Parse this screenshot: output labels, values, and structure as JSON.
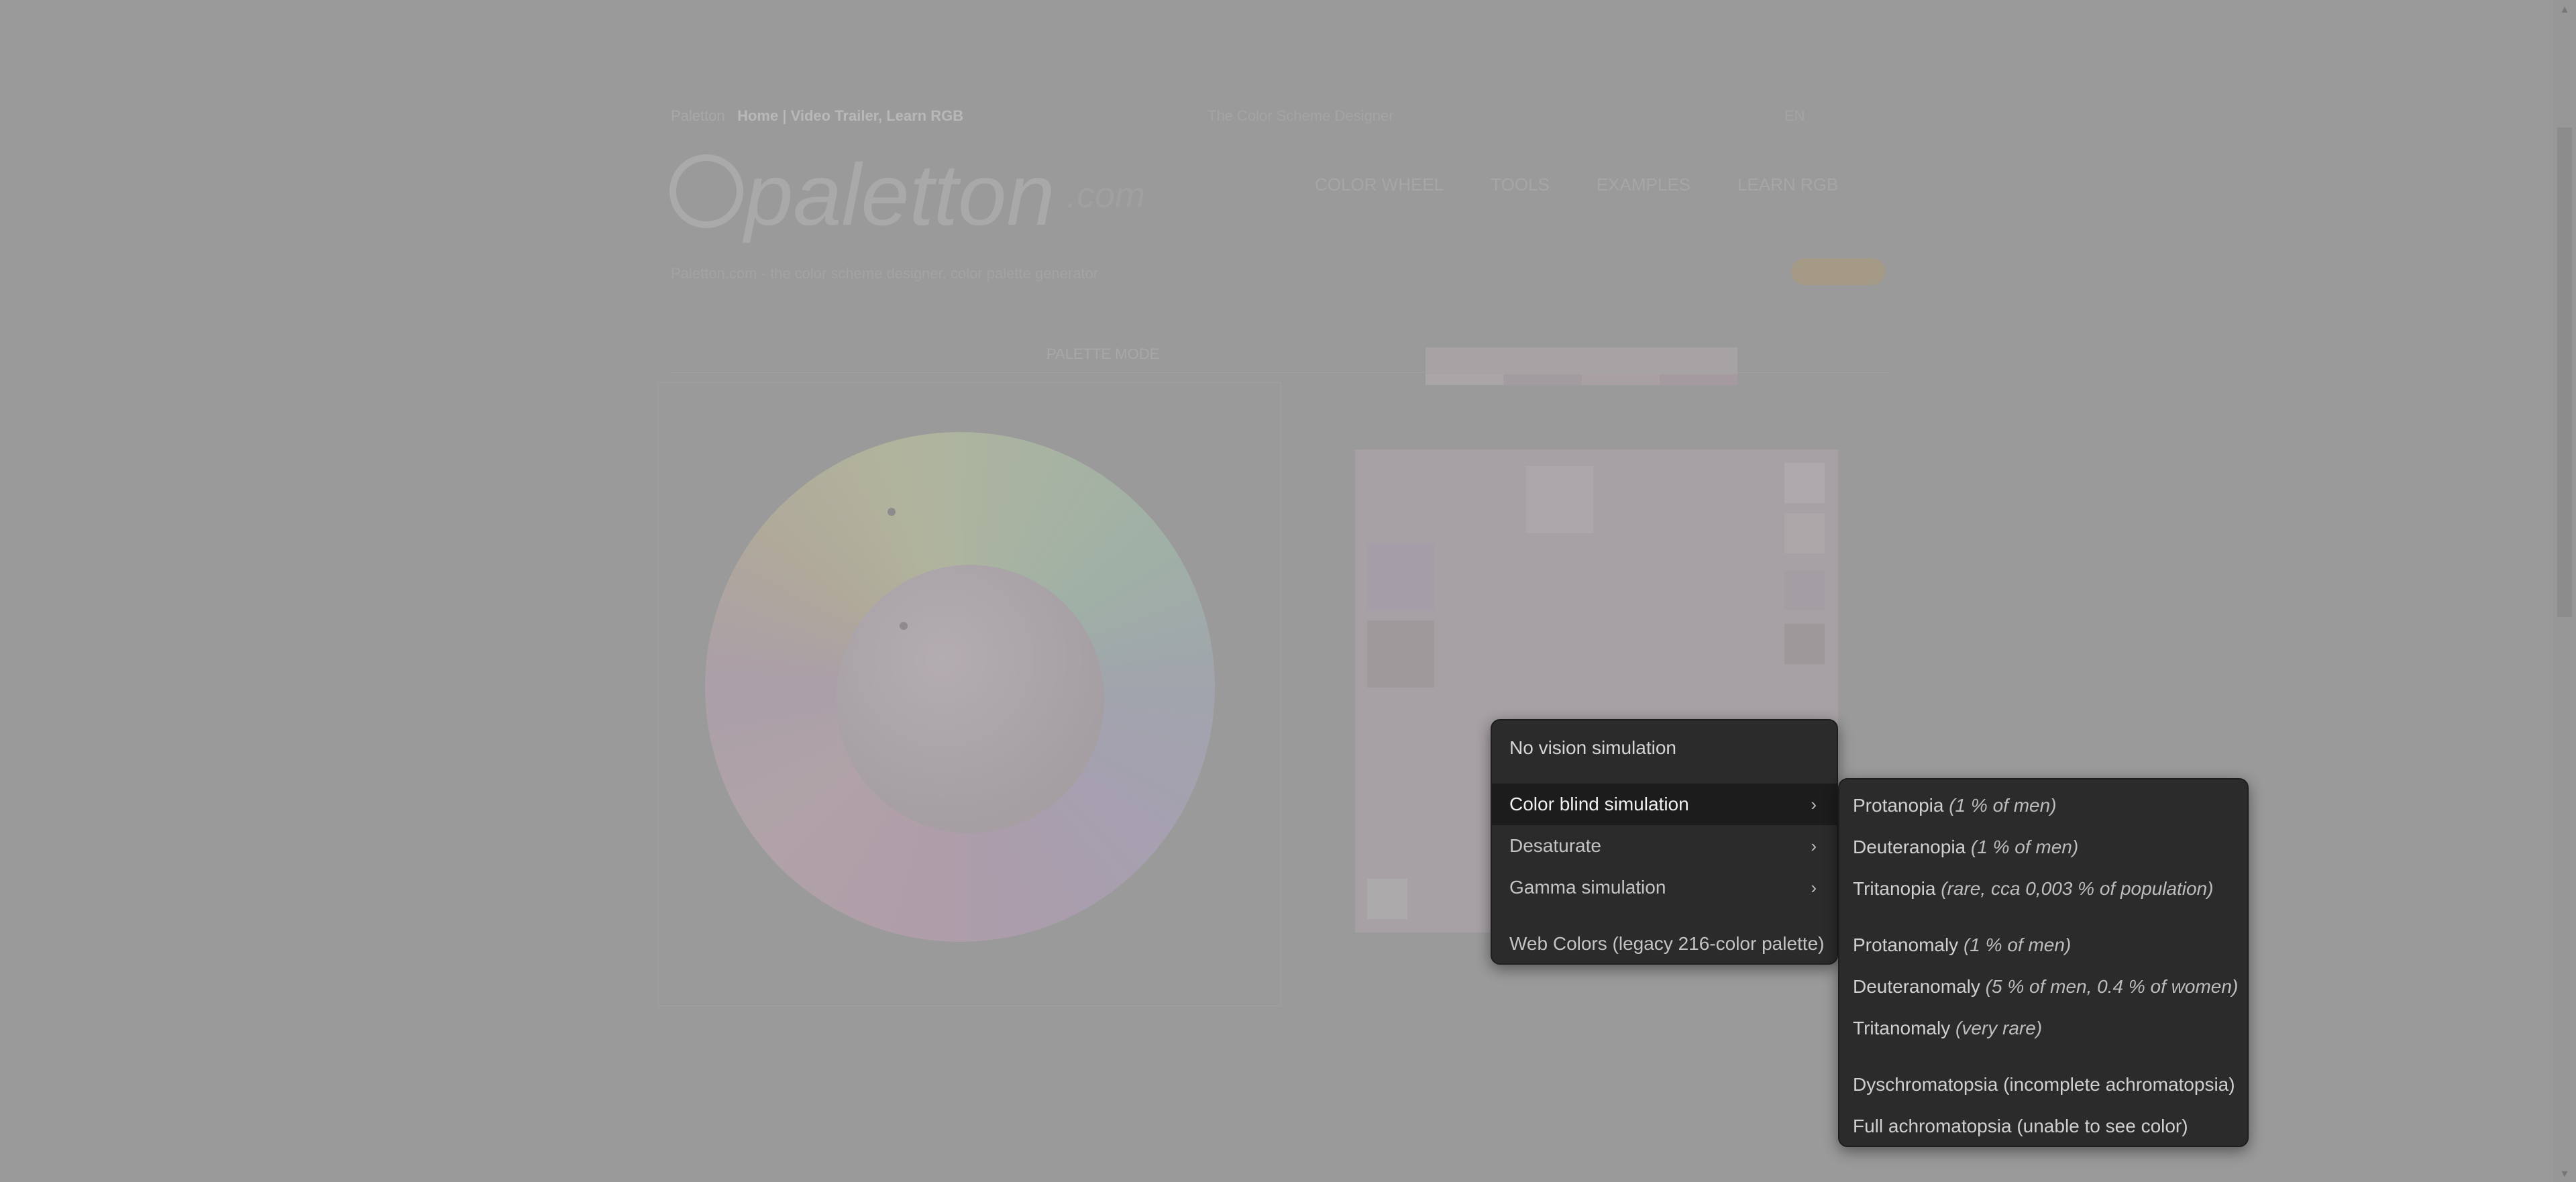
{
  "background_site": {
    "breadcrumb": "Paletton",
    "breadcrumb_highlight": "Home | Video Trailer, Learn RGB",
    "tagline": "The Color Scheme Designer",
    "language": "EN",
    "logo_text": "paletton",
    "logo_suffix": ".com",
    "nav": [
      "COLOR WHEEL",
      "TOOLS",
      "EXAMPLES",
      "LEARN RGB"
    ],
    "subline": "Paletton.com - the color scheme designer, color palette generator",
    "tab_label": "PALETTE MODE"
  },
  "main_menu": {
    "items": [
      {
        "label": "No vision simulation",
        "has_submenu": false
      },
      {
        "label": "Color blind simulation",
        "has_submenu": true,
        "active": true
      },
      {
        "label": "Desaturate",
        "has_submenu": true
      },
      {
        "label": "Gamma simulation",
        "has_submenu": true
      },
      {
        "label": "Web Colors (legacy 216-color palette)",
        "has_submenu": false
      }
    ],
    "submenu_arrow": "›"
  },
  "sub_menu": {
    "groups": [
      [
        {
          "name": "Protanopia",
          "note": "(1 % of men)"
        },
        {
          "name": "Deuteranopia",
          "note": "(1 % of men)"
        },
        {
          "name": "Tritanopia",
          "note": "(rare, cca 0,003 % of population)"
        }
      ],
      [
        {
          "name": "Protanomaly",
          "note": "(1 % of men)"
        },
        {
          "name": "Deuteranomaly",
          "note": "(5 % of men, 0.4 % of women)"
        },
        {
          "name": "Tritanomaly",
          "note": "(very rare)"
        }
      ],
      [
        {
          "name": "Dyschromatopsia (incomplete achromatopsia)",
          "note": ""
        },
        {
          "name": "Full achromatopsia (unable to see color)",
          "note": ""
        }
      ]
    ]
  },
  "colors": {
    "overlay": "#9a9a9a",
    "menu_bg": "#2b2b2b",
    "menu_hover": "#1c1c1c",
    "menu_text": "#d6d6d6"
  }
}
